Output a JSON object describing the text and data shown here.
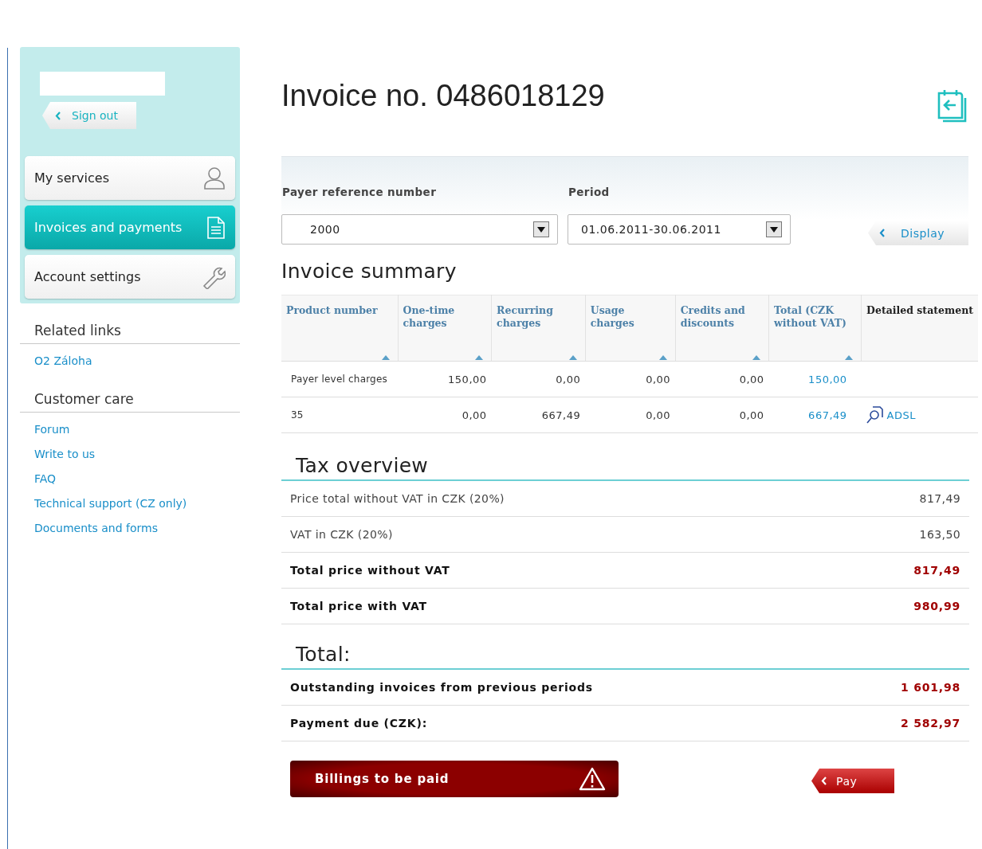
{
  "sidebar": {
    "sign_out": "Sign out",
    "nav": [
      {
        "label": "My services",
        "selected": false
      },
      {
        "label": "Invoices and payments",
        "selected": true
      },
      {
        "label": "Account settings",
        "selected": false
      }
    ],
    "sections": [
      {
        "title": "Related links",
        "links": [
          "O2 Záloha"
        ]
      },
      {
        "title": "Customer care",
        "links": [
          "Forum",
          "Write to us",
          "FAQ",
          "Technical support (CZ only)",
          "Documents and forms"
        ]
      }
    ]
  },
  "main": {
    "title": "Invoice no. 0486018129",
    "filters": [
      {
        "label": "Payer reference number",
        "value": "2000"
      },
      {
        "label": "Period",
        "value": "01.06.2011-30.06.2011"
      }
    ],
    "display_button": "Display",
    "summary": {
      "title": "Invoice summary",
      "columns": [
        {
          "label": "Product number",
          "sortable": true
        },
        {
          "label": "One-time charges",
          "sortable": true
        },
        {
          "label": "Recurring charges",
          "sortable": true
        },
        {
          "label": "Usage charges",
          "sortable": true
        },
        {
          "label": "Credits and discounts",
          "sortable": true
        },
        {
          "label": "Total (CZK without VAT)",
          "sortable": true
        },
        {
          "label": "Detailed statement",
          "sortable": false
        }
      ],
      "rows": [
        {
          "cells": [
            "Payer level charges",
            "150,00",
            "0,00",
            "0,00",
            "0,00",
            "150,00"
          ]
        },
        {
          "cells": [
            "35",
            "0,00",
            "667,49",
            "0,00",
            "0,00",
            "667,49"
          ],
          "statement": "ADSL"
        }
      ]
    },
    "tax": {
      "title": "Tax overview",
      "rows": [
        {
          "label": "Price total without VAT in CZK (20%)",
          "value": "817,49",
          "emphasis": false
        },
        {
          "label": "VAT in CZK (20%)",
          "value": "163,50",
          "emphasis": false
        },
        {
          "label": "Total price without VAT",
          "value": "817,49",
          "emphasis": true
        },
        {
          "label": "Total price with VAT",
          "value": "980,99",
          "emphasis": true
        }
      ]
    },
    "total": {
      "title": "Total:",
      "rows": [
        {
          "label": "Outstanding invoices from previous periods",
          "value": "1 601,98",
          "emphasis": true
        },
        {
          "label": "Payment due (CZK):",
          "value": "2 582,97",
          "emphasis": true
        }
      ]
    },
    "billings_button": "Billings to be paid",
    "pay_button": "Pay"
  }
}
